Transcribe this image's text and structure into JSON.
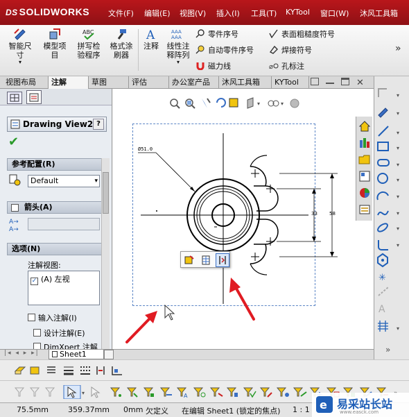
{
  "app": {
    "logo": "SOLIDWORKS",
    "logo_prefix": "DS"
  },
  "menu": [
    "文件(F)",
    "编辑(E)",
    "视图(V)",
    "插入(I)",
    "工具(T)",
    "KYTool",
    "窗口(W)",
    "沐风工具箱"
  ],
  "ribbon": {
    "large": [
      {
        "label1": "智能尺",
        "label2": "寸"
      },
      {
        "label1": "模型项",
        "label2": "目"
      },
      {
        "label1": "拼写检",
        "label2": "验程序"
      },
      {
        "label1": "格式涂",
        "label2": "刷器"
      },
      {
        "label1": "注释",
        "label2": ""
      },
      {
        "label1": "线性注",
        "label2": "释阵列"
      }
    ],
    "small_col1": [
      "零件序号",
      "自动零件序号",
      "磁力线"
    ],
    "small_col2": [
      "表面粗糙度符号",
      "焊接符号",
      "孔标注"
    ],
    "more": "»"
  },
  "tabs": [
    "视图布局",
    "注解",
    "草图",
    "评估",
    "办公室产品",
    "沐风工具箱",
    "KYTool"
  ],
  "active_tab": "注解",
  "panel": {
    "title": "Drawing View2",
    "help": "?",
    "sec_ref": "参考配置(R)",
    "config_value": "Default",
    "sec_arrow": "箭头(A)",
    "sec_options": "选项(N)",
    "annot_view_label": "注解视图:",
    "annot_view_item": "(A) 左视",
    "cb_insert": "输入注解(I)",
    "cb_design": "设计注解(E)",
    "cb_dimxpert": "DimXpert 注解"
  },
  "sheet_tab": "Sheet1",
  "drawing": {
    "diameter_label": "Ø51.0",
    "dim_right1": "33",
    "dim_right2": "58"
  },
  "status": {
    "x": "75.5mm",
    "y": "359.37mm",
    "z": "0mm",
    "state": "欠定义",
    "editing": "在编辑 Sheet1 (锁定的焦点)",
    "scale": "1 : 1"
  },
  "watermark": {
    "text": "易采站长站",
    "sub": "www.easck.com"
  },
  "colors": {
    "menubar": "#a3141a",
    "arrow": "#e01b22",
    "accent": "#1f5fb8"
  }
}
